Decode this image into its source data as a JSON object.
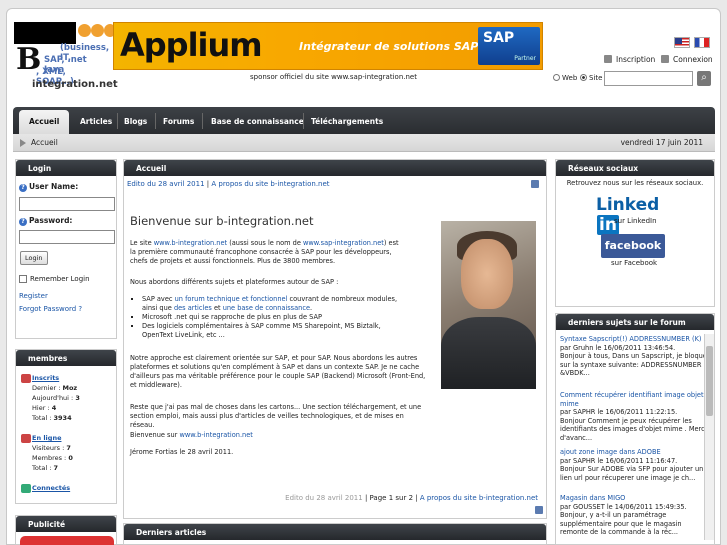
{
  "logo": {
    "top": "",
    "line1": "(business, IT,",
    "line2": "SAP, .net Java",
    "line3": ", XML, SOAP...)",
    "bottom": "integration.net"
  },
  "banner": {
    "brand": "Applium",
    "tagline": "Intégrateur de solutions SAP",
    "sap": "SAP",
    "partner": "Partner",
    "sponsor": "sponsor officiel du site www.sap-integration.net"
  },
  "account": {
    "signup": "Inscription",
    "login": "Connexion"
  },
  "search": {
    "web": "Web",
    "site": "Site",
    "value": ""
  },
  "nav": {
    "tabs": [
      "Accueil",
      "Articles",
      "Blogs",
      "Forums",
      "Base de connaissance",
      "Téléchargements"
    ]
  },
  "crumb": {
    "home": "Accueil",
    "date": "vendredi 17 juin 2011"
  },
  "login": {
    "title": "Login",
    "username": "User Name:",
    "password": "Password:",
    "button": "Login",
    "remember": "Remember Login",
    "register": "Register",
    "forgot": "Forgot Password ?"
  },
  "members": {
    "title": "membres",
    "inscrits": "Inscrits",
    "last": "Dernier :",
    "last_val": "Moz",
    "today": "Aujourd'hui :",
    "today_val": "3",
    "yesterday": "Hier :",
    "yesterday_val": "4",
    "total": "Total :",
    "total_val": "3934",
    "online": "En ligne",
    "visitors": "Visiteurs :",
    "visitors_val": "7",
    "members": "Membres :",
    "members_val": "0",
    "total2": "Total :",
    "total2_val": "7",
    "connected": "Connectés"
  },
  "pub": {
    "title": "Publicité"
  },
  "article": {
    "title": "Accueil",
    "edited": "Edito du 28 avril 2011",
    "sep": " | ",
    "about": "A propos du site b-integration.net",
    "heading": "Bienvenue sur b-integration.net",
    "p1a": "Le site ",
    "p1link1": "www.b-integration.net",
    "p1b": " (aussi sous le nom de ",
    "p1link2": "www.sap-integration.net",
    "p1c": ") est la première communauté francophone consacrée à SAP pour les développeurs, chefs de projets et aussi fonctionnels. Plus de 3800 membres.",
    "p2": "Nous abordons différents sujets et plateformes autour de SAP :",
    "li1a": "SAP avec ",
    "li1link": "un forum technique et fonctionnel",
    "li1b": " couvrant de nombreux modules, ainsi que ",
    "li1link2": "des articles",
    "li1c": " et ",
    "li1link3": "une base de connaissance",
    "li1d": ".",
    "li2": "Microsoft .net qui se rapproche de plus en plus de SAP",
    "li3": "Des logiciels complémentaires à SAP comme MS Sharepoint, MS Biztalk, OpenText LiveLink, etc ...",
    "p3": "Notre approche est clairement orientée sur SAP, et pour SAP. Nous abordons les autres plateformes et solutions qu'en complément à SAP et dans un contexte SAP. Je ne cache d'ailleurs pas ma véritable préférence pour le couple SAP (Backend) Microsoft (Front-End, et middleware).",
    "p4": "Reste que j'ai pas mal de choses dans les cartons... Une section téléchargement, et une section emploi, mais aussi plus d'articles de veilles technologiques, et de mises en réseau.",
    "p5a": "Bienvenue sur ",
    "p5link": "www.b-integration.net",
    "p6": "Jérome Fortias le 28 avril 2011.",
    "footer_edited": "Edito du 28 avril 2011",
    "footer_page": " | Page 1 sur 2 | ",
    "footer_about": "A propos du site b-integration.net"
  },
  "latest": {
    "title": "Derniers articles"
  },
  "social": {
    "title": "Réseaux sociaux",
    "intro": "Retrouvez nous sur les réseaux sociaux.",
    "linkedin_logo": "Linked",
    "linkedin_in": "in",
    "linkedin": "sur LinkedIn",
    "facebook_logo": "facebook",
    "facebook": "sur Facebook"
  },
  "forum": {
    "title": "derniers sujets sur le forum",
    "topics": [
      {
        "link": "Syntaxe Sapscript(!) ADDRESSNUMBER (K)",
        "by": "par Gruhn le 16/06/2011 13:46:54.",
        "text": "Bonjour à tous, Dans un Sapscript, je bloque sur la syntaxe suivante: ADDRESSNUMBER &VBDK..."
      },
      {
        "link": "Comment récupérer identifiant image objet mime",
        "by": "par SAPHR le 16/06/2011 11:22:15.",
        "text": "Bonjour Comment je peux récupérer les identifiants des images d'objet mime . Merci d'avanc..."
      },
      {
        "link": "ajout zone image dans ADOBE",
        "by": "par SAPHR le 16/06/2011 11:16:47.",
        "text": "Bonjour Sur ADOBE via SFP pour ajouter un lien url pour récuperer une image je ch..."
      },
      {
        "link": "Magasin dans MIGO",
        "by": "par GOUSSET le 14/06/2011 15:49:35.",
        "text": "Bonjour, y a-t-il un paramétrage supplémentaire pour que le magasin remonte de la commande à la réc..."
      }
    ]
  }
}
